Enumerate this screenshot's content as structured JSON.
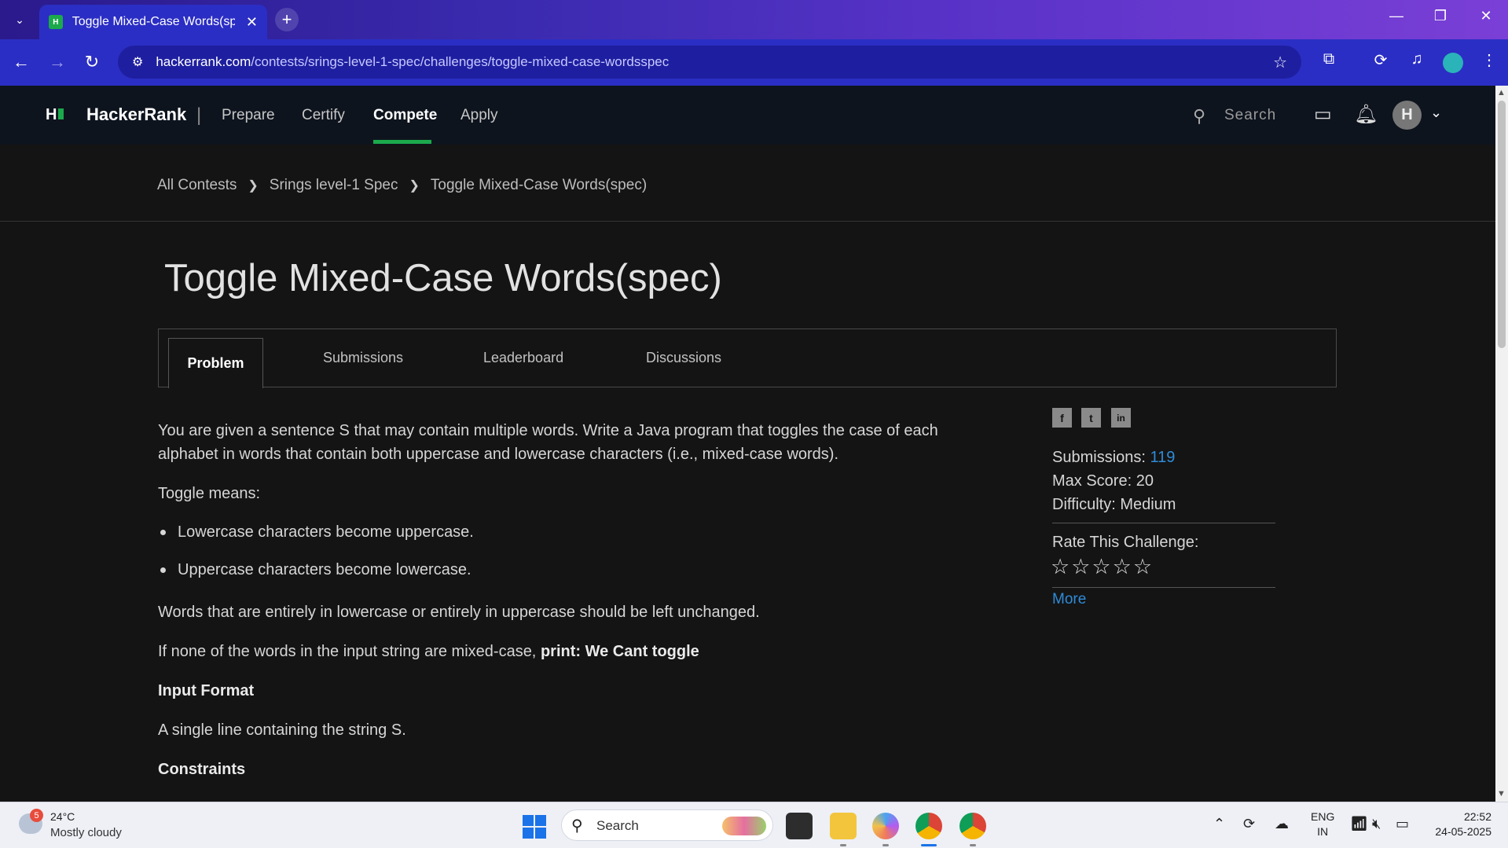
{
  "browser": {
    "tab_title": "Toggle Mixed-Case Words(spec)",
    "favicon_text": "H",
    "url_host": "hackerrank.com",
    "url_path": "/contests/srings-level-1-spec/challenges/toggle-mixed-case-wordsspec"
  },
  "header": {
    "logo_text": "HackerRank",
    "nav": [
      "Prepare",
      "Certify",
      "Compete",
      "Apply"
    ],
    "search_placeholder": "Search",
    "avatar_initial": "H"
  },
  "breadcrumb": [
    "All Contests",
    "Srings level-1 Spec",
    "Toggle Mixed-Case Words(spec)"
  ],
  "page_title": "Toggle Mixed-Case Words(spec)",
  "tabs": [
    "Problem",
    "Submissions",
    "Leaderboard",
    "Discussions"
  ],
  "problem": {
    "intro": "You are given a sentence S that may contain multiple words. Write a Java program that toggles the case of each alphabet in words that contain both uppercase and lowercase characters (i.e., mixed-case words).",
    "toggle_means": "Toggle means:",
    "bullets": [
      "Lowercase characters become uppercase.",
      "Uppercase characters become lowercase."
    ],
    "unchanged": "Words that are entirely in lowercase or entirely in uppercase should be left unchanged.",
    "none_prefix": "If none of the words in the input string are mixed-case, ",
    "none_bold": "print: We Cant toggle",
    "input_format_heading": "Input Format",
    "input_format": "A single line containing the string S.",
    "constraints_heading": "Constraints"
  },
  "sidebar": {
    "share_icons": [
      "f",
      "t",
      "in"
    ],
    "submissions_label": "Submissions:",
    "submissions_value": "119",
    "max_score": "Max Score: 20",
    "difficulty": "Difficulty: Medium",
    "rate_label": "Rate This Challenge:",
    "stars": "☆☆☆☆☆",
    "rating": 0,
    "more": "More"
  },
  "taskbar": {
    "weather_badge": "5",
    "temperature": "24°C",
    "condition": "Mostly cloudy",
    "search": "Search",
    "lang_top": "ENG",
    "lang_bottom": "IN",
    "time": "22:52",
    "date": "24-05-2025"
  },
  "colors": {
    "brand_green": "#1ba94c",
    "link_blue": "#2f8bd8",
    "page_bg": "#141414",
    "header_bg": "#0e141e"
  }
}
